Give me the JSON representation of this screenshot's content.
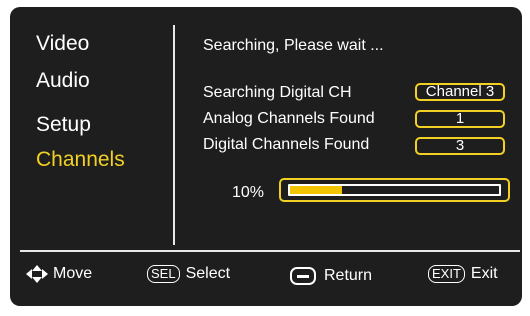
{
  "menu": {
    "items": [
      {
        "label": "Video"
      },
      {
        "label": "Audio"
      },
      {
        "label": "Setup"
      },
      {
        "label": "Channels",
        "active": true
      }
    ]
  },
  "scan": {
    "status": "Searching, Please wait ...",
    "rows": [
      {
        "label": "Searching Digital CH",
        "value": "Channel 3"
      },
      {
        "label": "Analog Channels Found",
        "value": "1"
      },
      {
        "label": "Digital Channels Found",
        "value": "3"
      }
    ],
    "progress_label": "10%",
    "progress_fraction": 0.25
  },
  "footer": {
    "move": "Move",
    "select_key": "SEL",
    "select": "Select",
    "return": "Return",
    "exit_key": "EXIT",
    "exit": "Exit"
  },
  "colors": {
    "background": "#1e1e1e",
    "accent": "#f2d024",
    "text": "#ffffff"
  }
}
